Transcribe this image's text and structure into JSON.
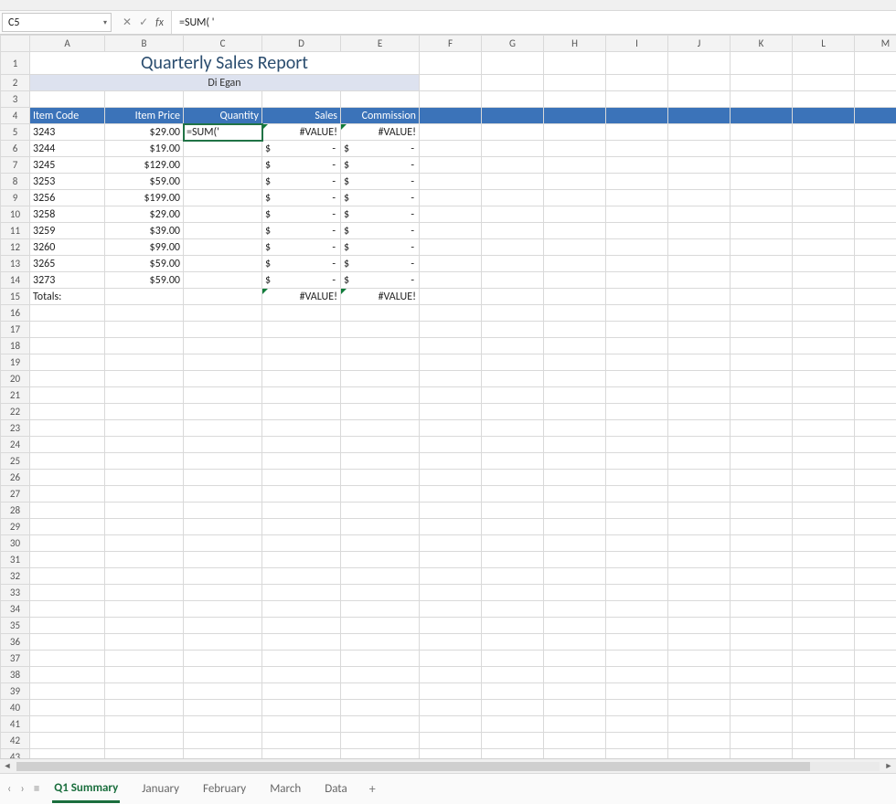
{
  "namebox": {
    "ref": "C5"
  },
  "formula_bar": {
    "fx_label": "fx",
    "value": "=SUM( '",
    "cancel": "✕",
    "enter": "✓"
  },
  "columns": [
    "A",
    "B",
    "C",
    "D",
    "E",
    "F",
    "G",
    "H",
    "I",
    "J",
    "K",
    "L",
    "M"
  ],
  "title": "Quarterly Sales Report",
  "subtitle": "Di Egan",
  "headers": {
    "item_code": "Item Code",
    "item_price": "Item Price",
    "quantity": "Quantity",
    "sales": "Sales",
    "commission": "Commission"
  },
  "active_cell_display": "=SUM('",
  "rows": [
    {
      "code": "3243",
      "price": "$29.00",
      "qty_mode": "active",
      "sales": "#VALUE!",
      "commission": "#VALUE!"
    },
    {
      "code": "3244",
      "price": "$19.00",
      "qty_mode": "blank",
      "sales": "dash",
      "commission": "dash"
    },
    {
      "code": "3245",
      "price": "$129.00",
      "qty_mode": "blank",
      "sales": "dash",
      "commission": "dash"
    },
    {
      "code": "3253",
      "price": "$59.00",
      "qty_mode": "blank",
      "sales": "dash",
      "commission": "dash"
    },
    {
      "code": "3256",
      "price": "$199.00",
      "qty_mode": "blank",
      "sales": "dash",
      "commission": "dash"
    },
    {
      "code": "3258",
      "price": "$29.00",
      "qty_mode": "blank",
      "sales": "dash",
      "commission": "dash"
    },
    {
      "code": "3259",
      "price": "$39.00",
      "qty_mode": "blank",
      "sales": "dash",
      "commission": "dash"
    },
    {
      "code": "3260",
      "price": "$99.00",
      "qty_mode": "blank",
      "sales": "dash",
      "commission": "dash"
    },
    {
      "code": "3265",
      "price": "$59.00",
      "qty_mode": "blank",
      "sales": "dash",
      "commission": "dash"
    },
    {
      "code": "3273",
      "price": "$59.00",
      "qty_mode": "blank",
      "sales": "dash",
      "commission": "dash"
    }
  ],
  "totals": {
    "label": "Totals:",
    "sales": "#VALUE!",
    "commission": "#VALUE!"
  },
  "money_symbol": "$",
  "dash": "-",
  "value_error": "#VALUE!",
  "tabs": {
    "items": [
      "Q1 Summary",
      "January",
      "February",
      "March",
      "Data"
    ],
    "active_index": 0,
    "add": "+"
  },
  "nav_icons": {
    "prev": "‹",
    "next": "›",
    "menu": "≡"
  }
}
